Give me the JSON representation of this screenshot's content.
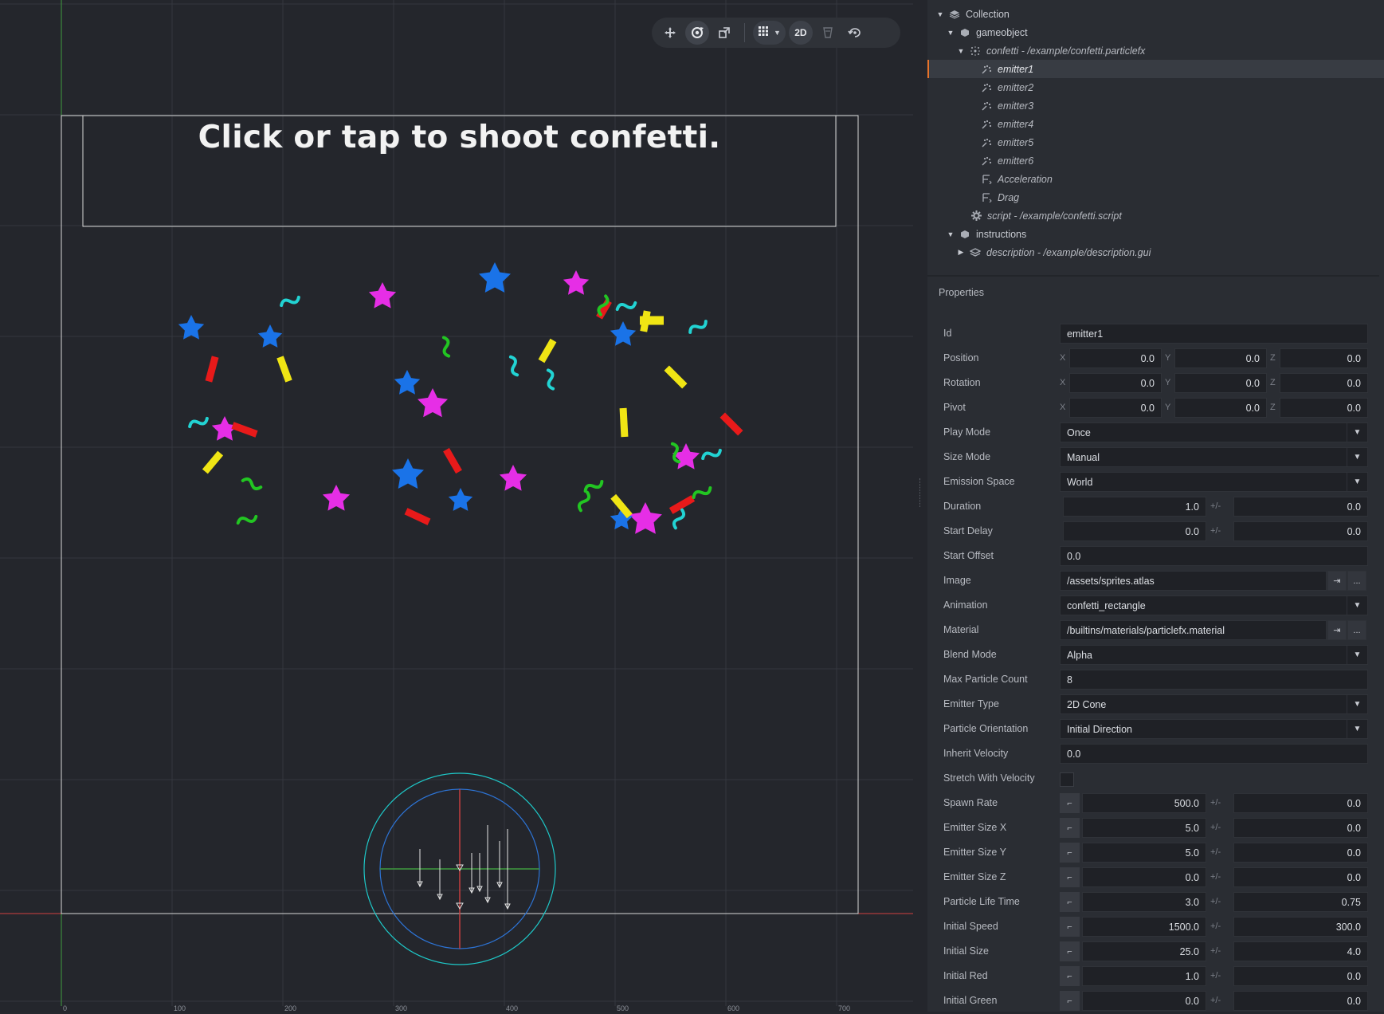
{
  "toolbar": {
    "move_icon": "move-tool-icon",
    "rotate_icon": "rotate-tool-icon",
    "scale_icon": "scale-tool-icon",
    "grid_icon": "grid-icon",
    "mode_label": "2D",
    "visibility_icon": "visibility-filter-icon",
    "camera_icon": "camera-reset-icon"
  },
  "scene": {
    "instruction_text": "Click or tap to shoot confetti.",
    "ruler_labels": [
      "0",
      "100",
      "200",
      "300",
      "400",
      "500",
      "600",
      "700"
    ],
    "colors": {
      "background": "#24262c",
      "grid": "#34373e",
      "blue": "#1a73e8",
      "magenta": "#e62ee6",
      "red": "#e81a1a",
      "yellow": "#f0e514",
      "green": "#22c522",
      "cyan": "#22d3d3",
      "x_axis": "#d04040",
      "y_axis": "#3f9c3f",
      "emitter_outer": "#1ec9c9",
      "emitter_inner": "#2d74d6"
    }
  },
  "outline": {
    "items": [
      {
        "label": "Collection",
        "icon": "collection-icon",
        "italic": false,
        "expanded": true
      },
      {
        "label": "gameobject",
        "icon": "gameobject-icon",
        "italic": false,
        "expanded": true
      },
      {
        "label": "confetti - /example/confetti.particlefx",
        "icon": "particlefx-icon",
        "italic": true,
        "expanded": true
      },
      {
        "label": "emitter1",
        "icon": "emitter-icon",
        "italic": true,
        "selected": true
      },
      {
        "label": "emitter2",
        "icon": "emitter-icon",
        "italic": true
      },
      {
        "label": "emitter3",
        "icon": "emitter-icon",
        "italic": true
      },
      {
        "label": "emitter4",
        "icon": "emitter-icon",
        "italic": true
      },
      {
        "label": "emitter5",
        "icon": "emitter-icon",
        "italic": true
      },
      {
        "label": "emitter6",
        "icon": "emitter-icon",
        "italic": true
      },
      {
        "label": "Acceleration",
        "icon": "modifier-icon",
        "italic": true
      },
      {
        "label": "Drag",
        "icon": "modifier-icon",
        "italic": true
      },
      {
        "label": "script - /example/confetti.script",
        "icon": "script-icon",
        "italic": true
      },
      {
        "label": "instructions",
        "icon": "gameobject-icon",
        "italic": false,
        "expanded": true
      },
      {
        "label": "description - /example/description.gui",
        "icon": "gui-icon",
        "italic": true,
        "expanded": false
      }
    ]
  },
  "properties": {
    "title": "Properties",
    "id": {
      "label": "Id",
      "value": "emitter1"
    },
    "position": {
      "label": "Position",
      "x": "0.0",
      "y": "0.0",
      "z": "0.0"
    },
    "rotation": {
      "label": "Rotation",
      "x": "0.0",
      "y": "0.0",
      "z": "0.0"
    },
    "pivot": {
      "label": "Pivot",
      "x": "0.0",
      "y": "0.0",
      "z": "0.0"
    },
    "axis_x": "X",
    "axis_y": "Y",
    "axis_z": "Z",
    "pm": "+/-",
    "play_mode": {
      "label": "Play Mode",
      "value": "Once"
    },
    "size_mode": {
      "label": "Size Mode",
      "value": "Manual"
    },
    "emission_space": {
      "label": "Emission Space",
      "value": "World"
    },
    "duration": {
      "label": "Duration",
      "value": "1.0",
      "spread": "0.0"
    },
    "start_delay": {
      "label": "Start Delay",
      "value": "0.0",
      "spread": "0.0"
    },
    "start_offset": {
      "label": "Start Offset",
      "value": "0.0"
    },
    "image": {
      "label": "Image",
      "value": "/assets/sprites.atlas"
    },
    "animation": {
      "label": "Animation",
      "value": "confetti_rectangle"
    },
    "material": {
      "label": "Material",
      "value": "/builtins/materials/particlefx.material"
    },
    "blend_mode": {
      "label": "Blend Mode",
      "value": "Alpha"
    },
    "max_particle_count": {
      "label": "Max Particle Count",
      "value": "8"
    },
    "emitter_type": {
      "label": "Emitter Type",
      "value": "2D Cone"
    },
    "particle_orientation": {
      "label": "Particle Orientation",
      "value": "Initial Direction"
    },
    "inherit_velocity": {
      "label": "Inherit Velocity",
      "value": "0.0"
    },
    "stretch_with_velocity": {
      "label": "Stretch With Velocity",
      "checked": false
    },
    "spawn_rate": {
      "label": "Spawn Rate",
      "value": "500.0",
      "spread": "0.0"
    },
    "emitter_size_x": {
      "label": "Emitter Size X",
      "value": "5.0",
      "spread": "0.0"
    },
    "emitter_size_y": {
      "label": "Emitter Size Y",
      "value": "5.0",
      "spread": "0.0"
    },
    "emitter_size_z": {
      "label": "Emitter Size Z",
      "value": "0.0",
      "spread": "0.0"
    },
    "particle_life_time": {
      "label": "Particle Life Time",
      "value": "3.0",
      "spread": "0.75"
    },
    "initial_speed": {
      "label": "Initial Speed",
      "value": "1500.0",
      "spread": "300.0"
    },
    "initial_size": {
      "label": "Initial Size",
      "value": "25.0",
      "spread": "4.0"
    },
    "initial_red": {
      "label": "Initial Red",
      "value": "1.0",
      "spread": "0.0"
    },
    "initial_green": {
      "label": "Initial Green",
      "value": "0.0",
      "spread": "0.0"
    },
    "goto_label": "⇥",
    "browse_label": "...",
    "dropdown_icon": "chevron-down-icon",
    "curve_icon": "curve-editor-icon"
  }
}
